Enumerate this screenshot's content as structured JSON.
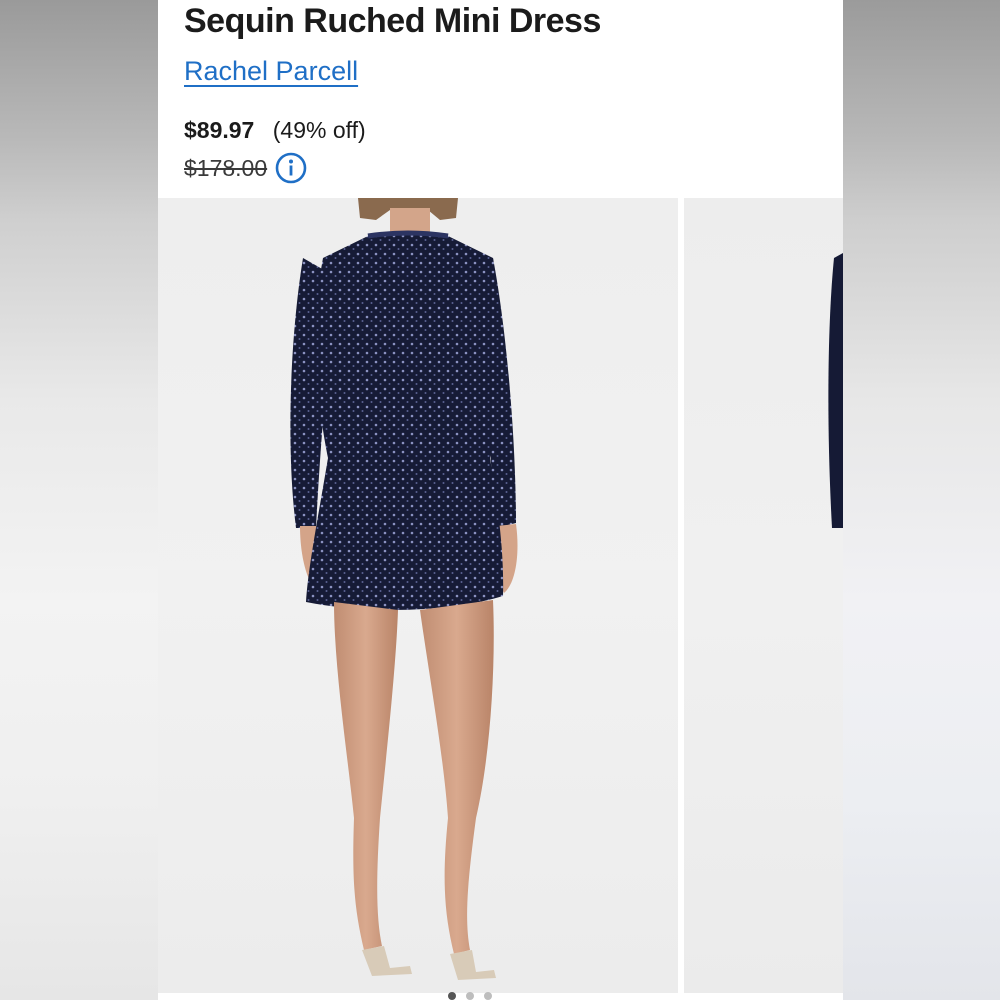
{
  "product": {
    "title": "Sequin Ruched Mini Dress",
    "brand": "Rachel Parcell",
    "price_current": "$89.97",
    "discount": "(49% off)",
    "price_original": "$178.00"
  },
  "icons": {
    "info": "info-icon"
  },
  "colors": {
    "brand_link": "#1f6fc6",
    "dress": "#151a35",
    "background": "#ffffff"
  },
  "gallery": {
    "image_count": 3,
    "active_index": 0
  }
}
